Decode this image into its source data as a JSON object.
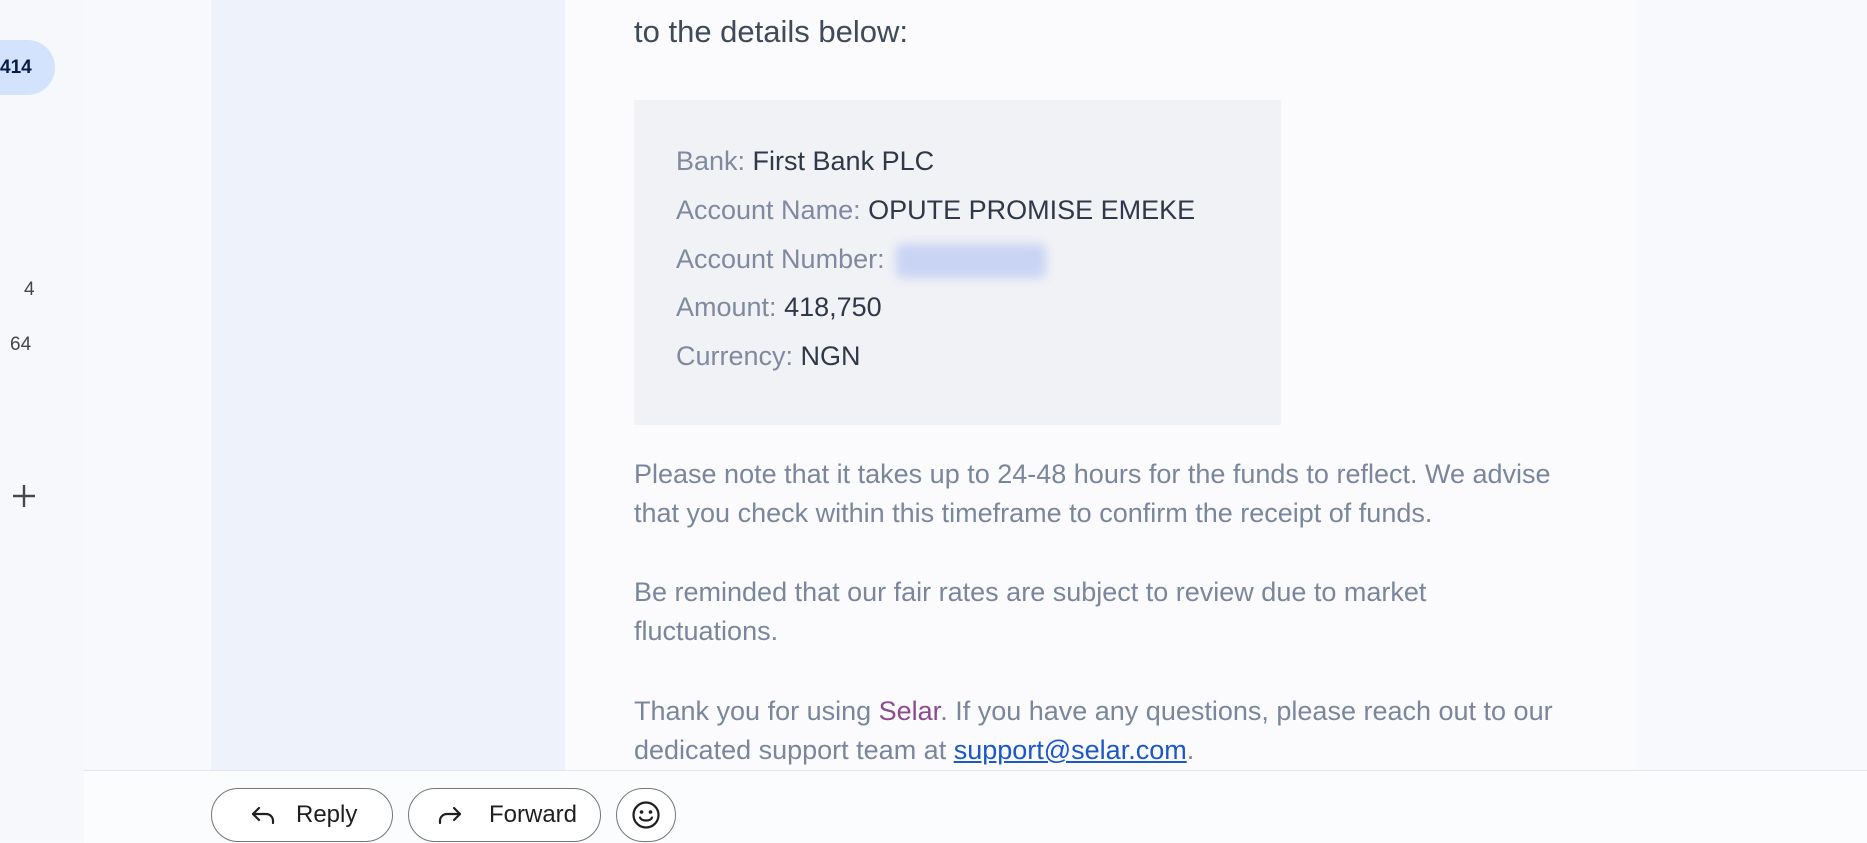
{
  "nav": {
    "badge": "414",
    "counts": [
      "4",
      "64"
    ],
    "add_icon": "plus-icon"
  },
  "email": {
    "intro": "to the details below:",
    "details": [
      {
        "label": "Bank: ",
        "value": "First Bank PLC"
      },
      {
        "label": "Account Name: ",
        "value": "OPUTE PROMISE EMEKE"
      },
      {
        "label": "Account Number: ",
        "value": ""
      },
      {
        "label": "Amount: ",
        "value": "418,750"
      },
      {
        "label": "Currency: ",
        "value": "NGN"
      }
    ],
    "note": "Please note that it takes up to 24-48 hours for the funds to reflect. We advise that you check within this timeframe to confirm the receipt of funds.",
    "reminder": "Be reminded that our fair rates are subject to review due to market fluctuations.",
    "thanks_prefix": "Thank you for using ",
    "brand": "Selar",
    "thanks_middle": ". If you have any questions, please reach out to our dedicated support team at ",
    "support_email": "support@selar.com",
    "thanks_suffix": "."
  },
  "actions": {
    "reply_label": "Reply",
    "reply_icon": "reply-icon",
    "forward_label": "Forward",
    "forward_icon": "forward-icon",
    "emoji_icon": "emoji-smile-icon"
  },
  "colors": {
    "badge_bg": "#d3e3fd",
    "brand": "#8c4b8a",
    "link": "#1a57c9"
  }
}
